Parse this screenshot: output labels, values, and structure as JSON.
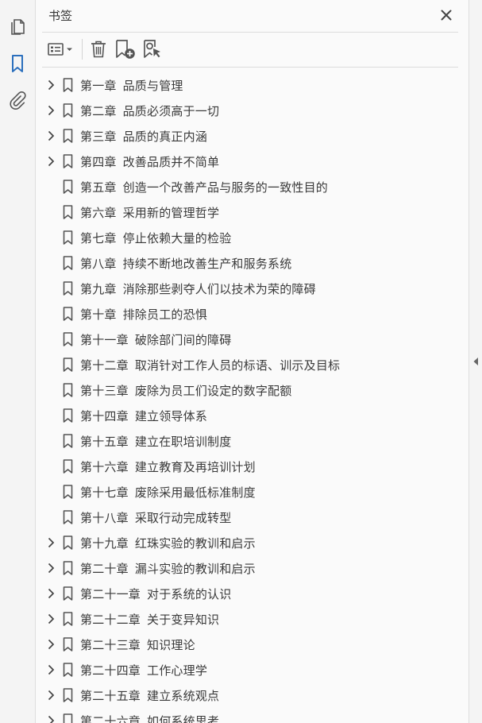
{
  "panel": {
    "title": "书签"
  },
  "rail": {
    "items": [
      {
        "name": "page-thumbnails-icon"
      },
      {
        "name": "bookmarks-icon",
        "active": true
      },
      {
        "name": "attachments-icon"
      }
    ]
  },
  "toolbar": {
    "buttons": [
      "options-menu-icon",
      "delete-bookmark-icon",
      "new-bookmark-icon",
      "find-current-bookmark-icon"
    ]
  },
  "colors": {
    "accent": "#2b6fbd",
    "icon": "#555555",
    "text": "#3a3a3a"
  },
  "bookmarks": [
    {
      "chapter": "第一章",
      "title": "品质与管理",
      "expandable": true
    },
    {
      "chapter": "第二章",
      "title": "品质必须高于一切",
      "expandable": true
    },
    {
      "chapter": "第三章",
      "title": "品质的真正内涵",
      "expandable": true
    },
    {
      "chapter": "第四章",
      "title": "改善品质并不简单",
      "expandable": true
    },
    {
      "chapter": "第五章",
      "title": "创造一个改善产品与服务的一致性目的",
      "expandable": false
    },
    {
      "chapter": "第六章",
      "title": "采用新的管理哲学",
      "expandable": false
    },
    {
      "chapter": "第七章",
      "title": "停止依赖大量的检验",
      "expandable": false
    },
    {
      "chapter": "第八章",
      "title": "持续不断地改善生产和服务系统",
      "expandable": false
    },
    {
      "chapter": "第九章",
      "title": "消除那些剥夺人们以技术为荣的障碍",
      "expandable": false
    },
    {
      "chapter": "第十章",
      "title": "排除员工的恐惧",
      "expandable": false
    },
    {
      "chapter": "第十一章",
      "title": "破除部门间的障碍",
      "expandable": false
    },
    {
      "chapter": "第十二章",
      "title": "取消针对工作人员的标语、训示及目标",
      "expandable": false
    },
    {
      "chapter": "第十三章",
      "title": "废除为员工们设定的数字配额",
      "expandable": false
    },
    {
      "chapter": "第十四章",
      "title": "建立领导体系",
      "expandable": false
    },
    {
      "chapter": "第十五章",
      "title": "建立在职培训制度",
      "expandable": false
    },
    {
      "chapter": "第十六章",
      "title": "建立教育及再培训计划",
      "expandable": false
    },
    {
      "chapter": "第十七章",
      "title": "废除采用最低标准制度",
      "expandable": false
    },
    {
      "chapter": "第十八章",
      "title": "采取行动完成转型",
      "expandable": false
    },
    {
      "chapter": "第十九章",
      "title": "红珠实验的教训和启示",
      "expandable": true
    },
    {
      "chapter": "第二十章",
      "title": "漏斗实验的教训和启示",
      "expandable": true
    },
    {
      "chapter": "第二十一章",
      "title": "对于系统的认识",
      "expandable": true
    },
    {
      "chapter": "第二十二章",
      "title": "关于变异知识",
      "expandable": true
    },
    {
      "chapter": "第二十三章",
      "title": "知识理论",
      "expandable": true
    },
    {
      "chapter": "第二十四章",
      "title": "工作心理学",
      "expandable": true
    },
    {
      "chapter": "第二十五章",
      "title": "建立系统观点",
      "expandable": true
    },
    {
      "chapter": "第二十六章",
      "title": "如何系统思考",
      "expandable": true
    }
  ]
}
